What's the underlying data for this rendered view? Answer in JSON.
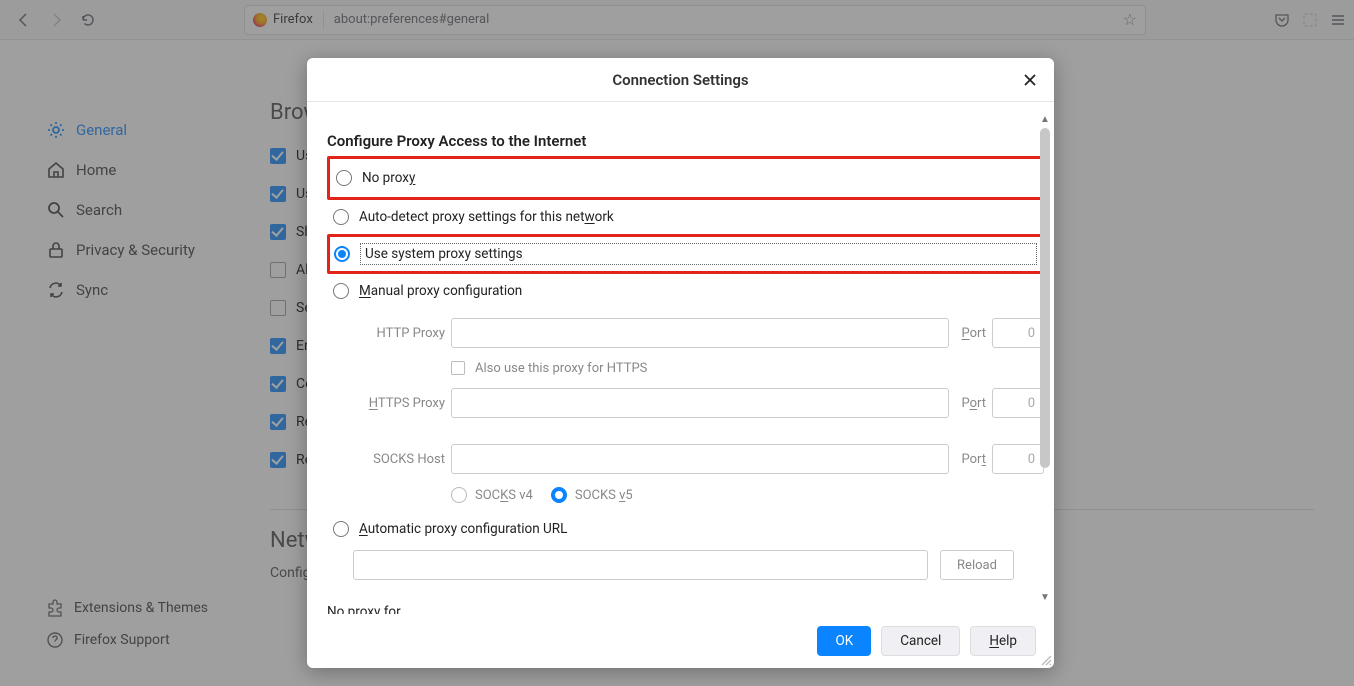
{
  "toolbar": {
    "firefox_label": "Firefox",
    "url": "about:preferences#general"
  },
  "sidebar": {
    "items": [
      {
        "label": "General"
      },
      {
        "label": "Home"
      },
      {
        "label": "Search"
      },
      {
        "label": "Privacy & Security"
      },
      {
        "label": "Sync"
      }
    ],
    "bottom": [
      {
        "label": "Extensions & Themes"
      },
      {
        "label": "Firefox Support"
      }
    ]
  },
  "background": {
    "section1": "Brow",
    "rows": [
      "Us",
      "Us",
      "Sh",
      "Al",
      "Se",
      "En",
      "Co",
      "Re",
      "Re"
    ],
    "section2": "Netw",
    "configure": "Config"
  },
  "dialog": {
    "title": "Connection Settings",
    "section_head": "Configure Proxy Access to the Internet",
    "radios": {
      "no_proxy_pre": "No prox",
      "no_proxy_ul": "y",
      "auto_detect_pre": "Auto-detect proxy settings for this net",
      "auto_detect_ul": "w",
      "auto_detect_post": "ork",
      "use_system": "Use system proxy settings",
      "manual_ul": "M",
      "manual_post": "anual proxy configuration",
      "auto_url_ul": "A",
      "auto_url_post": "utomatic proxy configuration URL"
    },
    "fields": {
      "http_label": "HTTP Proxy",
      "https_label_ul": "H",
      "https_label_post": "TTPS Proxy",
      "socks_label": "SOCKS Host",
      "port_label_ul": "P",
      "port_label_post": "ort",
      "port_label2_pre": "P",
      "port_label2_ul": "o",
      "port_label2_post": "rt",
      "port_label3_pre": "Por",
      "port_label3_ul": "t",
      "port_value": "0",
      "also_https": "Also use this proxy for HTTPS",
      "socks4_pre": "SOC",
      "socks4_ul": "K",
      "socks4_post": "S v4",
      "socks5_pre": "SOCKS ",
      "socks5_ul": "v",
      "socks5_post": "5",
      "reload": "Reload",
      "noproxyfor": "No proxy for"
    },
    "buttons": {
      "ok": "OK",
      "cancel": "Cancel",
      "help_ul": "H",
      "help_post": "elp"
    }
  }
}
